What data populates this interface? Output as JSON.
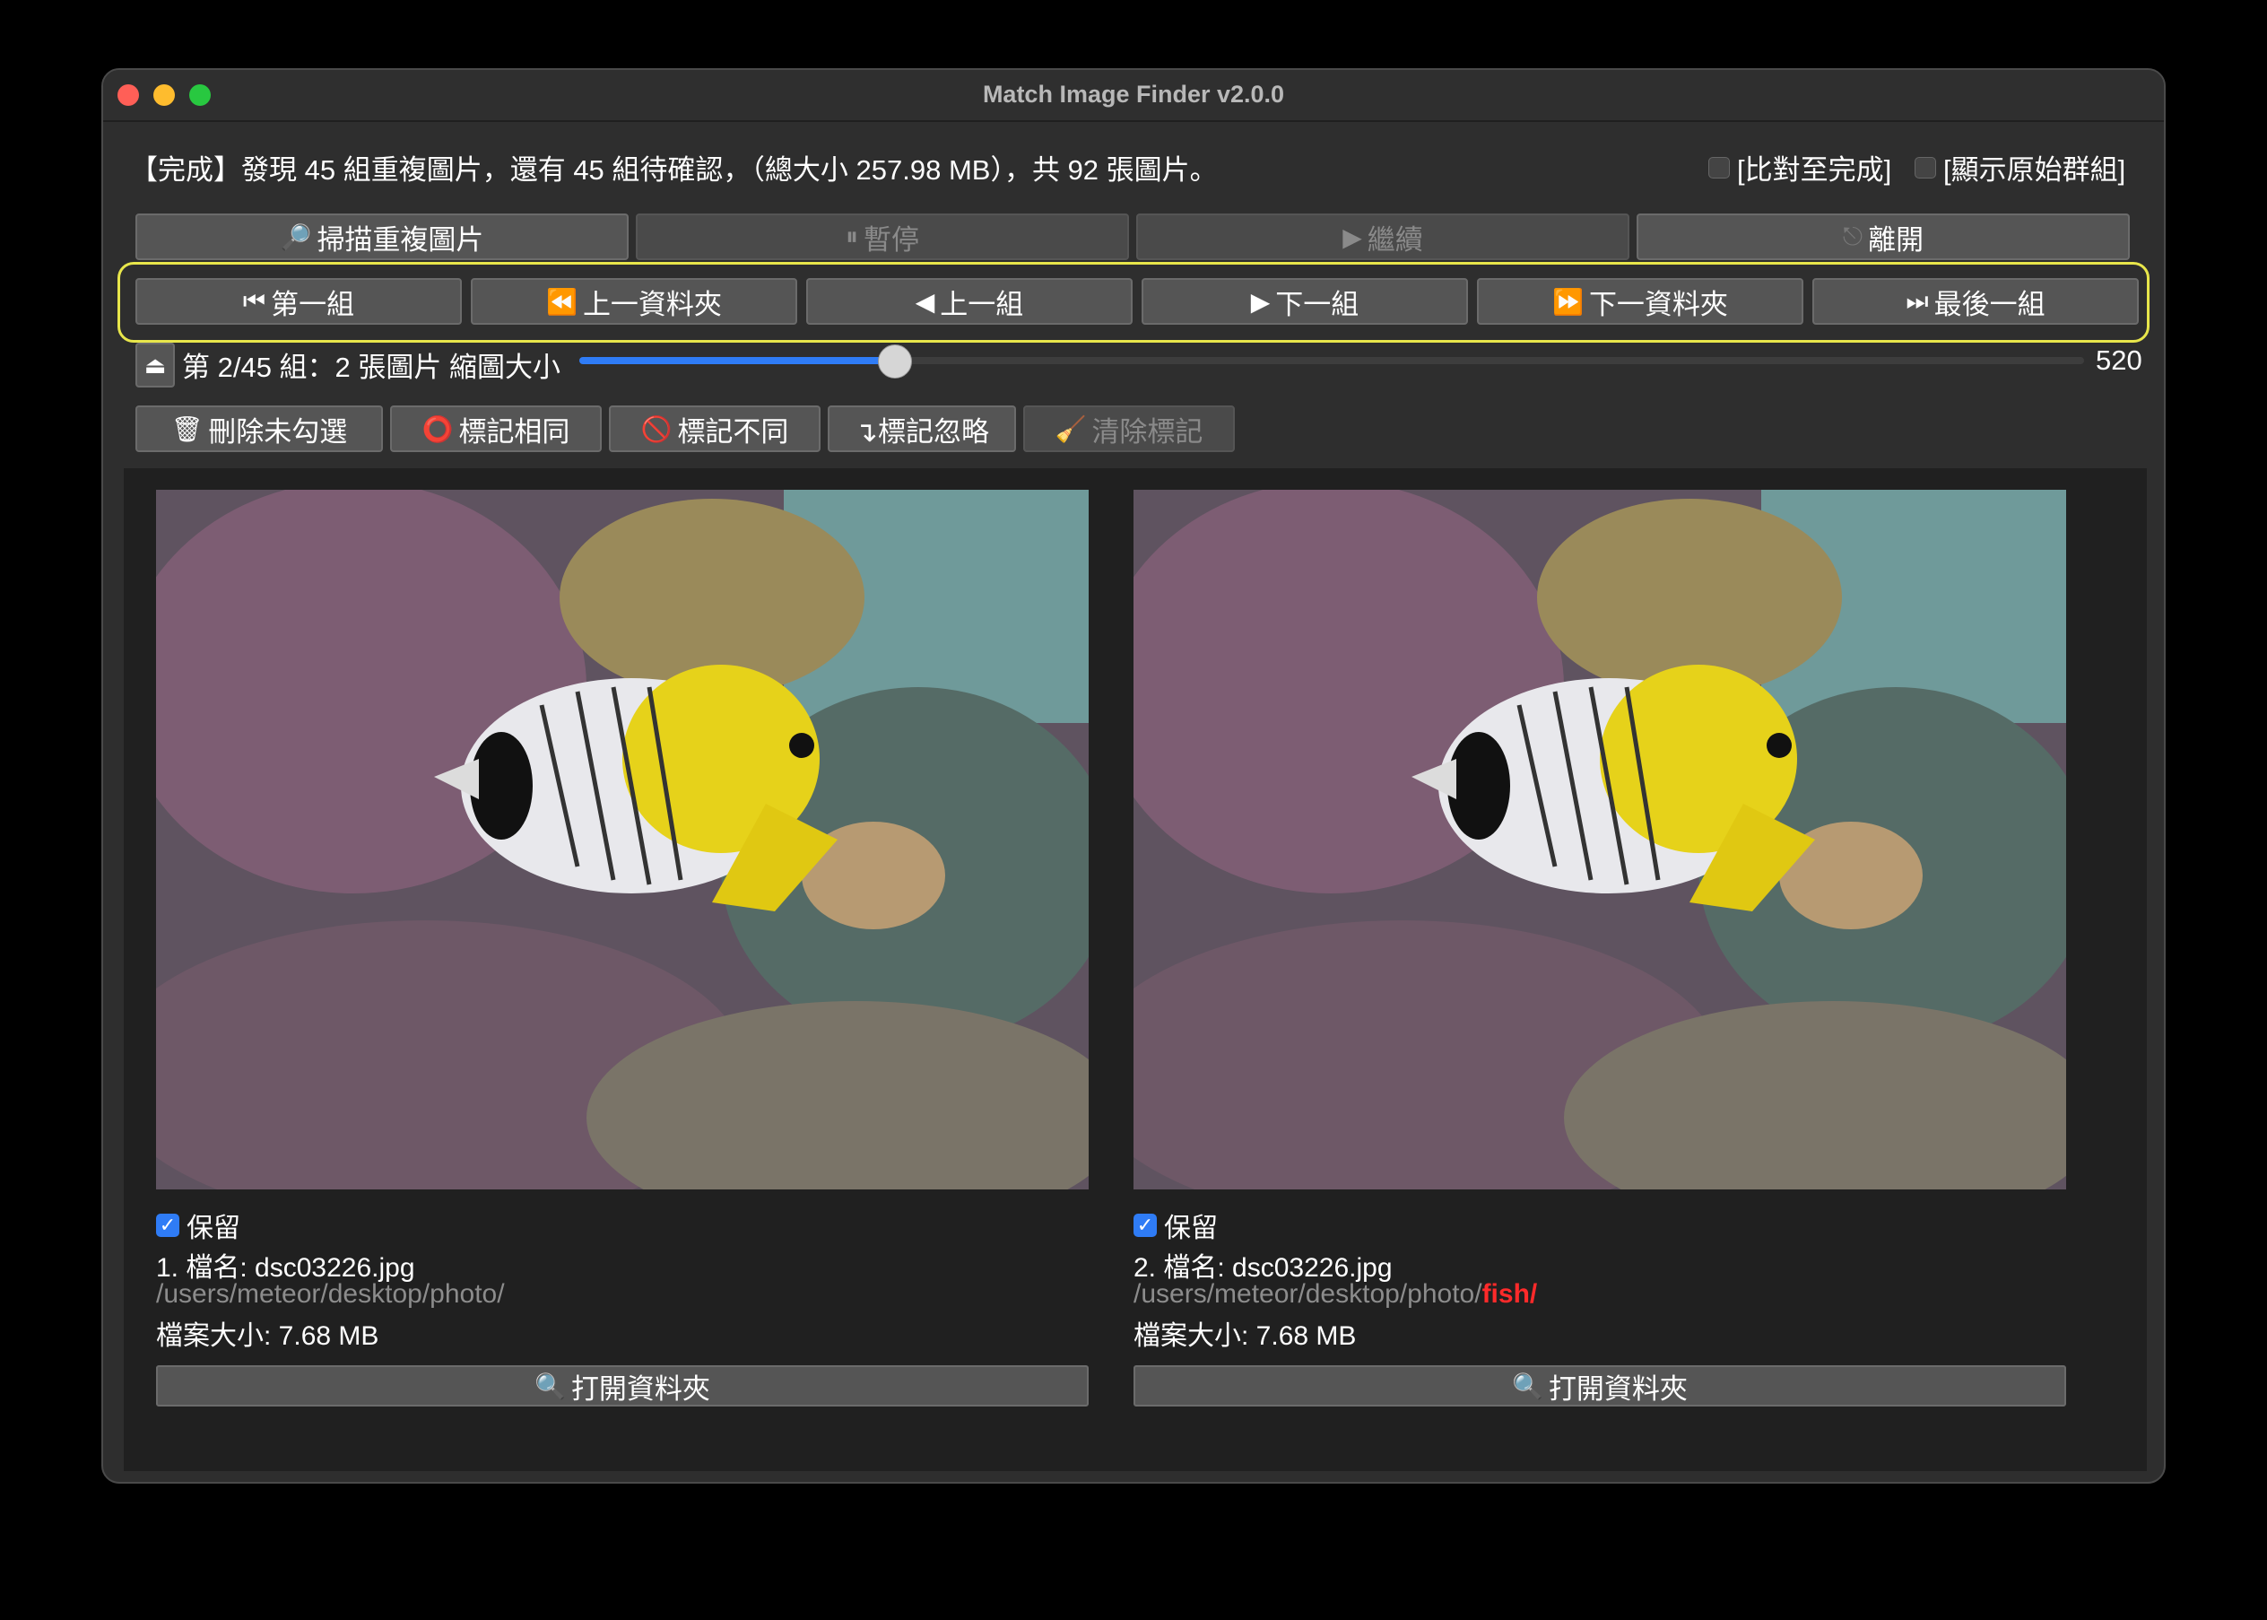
{
  "window": {
    "title": "Match Image Finder v2.0.0"
  },
  "status": {
    "text": "【完成】發現 45 組重複圖片，還有 45 組待確認，（總大小 257.98 MB），共 92 張圖片。",
    "option_complete": "[比對至完成]",
    "option_original_group": "[顯示原始群組]"
  },
  "toolbar": {
    "scan": "掃描重複圖片",
    "pause": "暫停",
    "resume": "繼續",
    "exit": "離開"
  },
  "nav": {
    "first": "第一組",
    "prev_folder": "上一資料夾",
    "prev": "上一組",
    "next": "下一組",
    "next_folder": "下一資料夾",
    "last": "最後一組"
  },
  "group": {
    "info": "第 2/45 組：2 張圖片 縮圖大小",
    "thumb_value": "520",
    "slider_fraction": 0.21
  },
  "actions": {
    "delete_unchecked": "刪除未勾選",
    "mark_same": "標記相同",
    "mark_different": "標記不同",
    "mark_ignore": "↴標記忽略",
    "clear_marks": "清除標記"
  },
  "images": [
    {
      "keep_label": "保留",
      "name": "1. 檔名: dsc03226.jpg",
      "path": "/users/meteor/desktop/photo/",
      "path_highlight": "",
      "size": "檔案大小: 7.68 MB",
      "open_folder": "打開資料夾"
    },
    {
      "keep_label": "保留",
      "name": "2. 檔名: dsc03226.jpg",
      "path": "/users/meteor/desktop/photo/",
      "path_highlight": "fish/",
      "size": "檔案大小: 7.68 MB",
      "open_folder": "打開資料夾"
    }
  ],
  "colors": {
    "accent": "#2f7cf6",
    "highlight_border": "#e8e64b",
    "path_diff": "#ff2a2a"
  }
}
